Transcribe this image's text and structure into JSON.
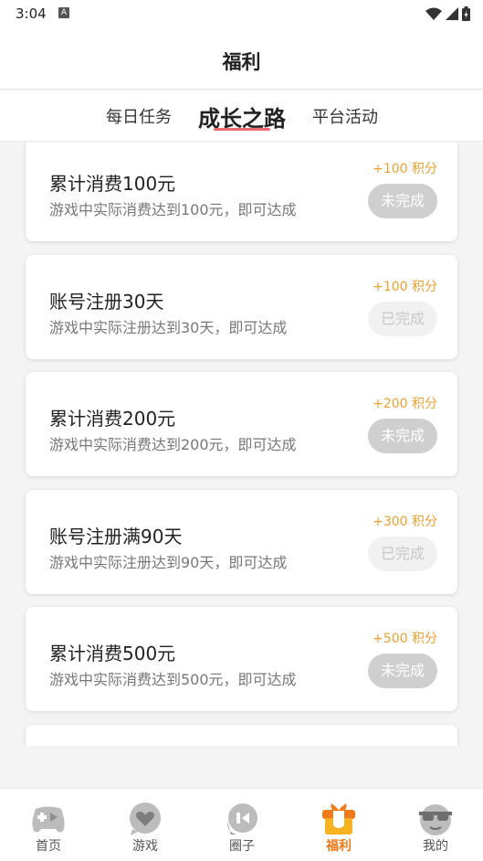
{
  "status_bar": {
    "time": "3:04",
    "notif_letter": "A"
  },
  "header": {
    "title": "福利"
  },
  "tabs": [
    {
      "label": "每日任务",
      "active": false
    },
    {
      "label": "成长之路",
      "active": true
    },
    {
      "label": "平台活动",
      "active": false
    }
  ],
  "tasks": [
    {
      "title": "累计消费100元",
      "desc": "游戏中实际消费达到100元，即可达成",
      "points": "+100 积分",
      "status": "未完成",
      "state": "todo"
    },
    {
      "title": "账号注册30天",
      "desc": "游戏中实际注册达到30天，即可达成",
      "points": "+100 积分",
      "status": "已完成",
      "state": "done"
    },
    {
      "title": "累计消费200元",
      "desc": "游戏中实际消费达到200元，即可达成",
      "points": "+200 积分",
      "status": "未完成",
      "state": "todo"
    },
    {
      "title": "账号注册满90天",
      "desc": "游戏中实际注册达到90天，即可达成",
      "points": "+300 积分",
      "status": "已完成",
      "state": "done"
    },
    {
      "title": "累计消费500元",
      "desc": "游戏中实际消费达到500元，即可达成",
      "points": "+500 积分",
      "status": "未完成",
      "state": "todo"
    }
  ],
  "nav": [
    {
      "label": "首页",
      "icon": "gamepad-icon",
      "active": false
    },
    {
      "label": "游戏",
      "icon": "heart-bubble-icon",
      "active": false
    },
    {
      "label": "圈子",
      "icon": "circle-chat-icon",
      "active": false
    },
    {
      "label": "福利",
      "icon": "gift-icon",
      "active": true
    },
    {
      "label": "我的",
      "icon": "sunglasses-face-icon",
      "active": false
    }
  ],
  "colors": {
    "accent": "#f07a1a",
    "points": "#f0a030",
    "tab_underline": "#ef6a6a"
  }
}
